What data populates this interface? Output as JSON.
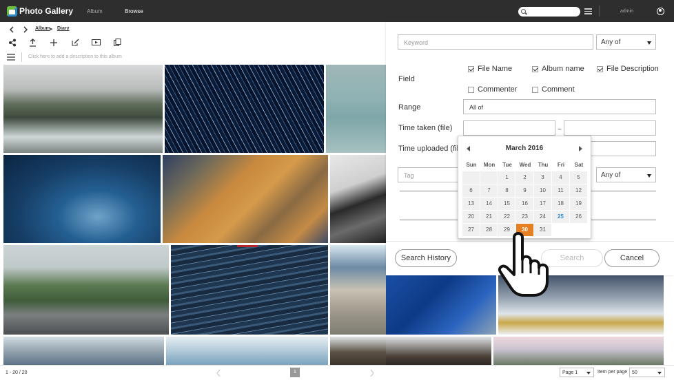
{
  "app": {
    "title": "Photo Gallery"
  },
  "nav": {
    "album": "Album",
    "browse": "Browse"
  },
  "header": {
    "user": "admin"
  },
  "breadcrumb": {
    "album": "Album",
    "sep": "▸",
    "current": "Diary"
  },
  "album": {
    "description_placeholder": "Click here to add a description to this album"
  },
  "icons": [
    "share-icon",
    "upload-icon",
    "add-icon",
    "edit-icon",
    "slideshow-icon",
    "copy-icon",
    "menu-icon",
    "search-icon",
    "filter-icon",
    "user-icon",
    "chevron-left-icon",
    "chevron-right-icon"
  ],
  "search": {
    "keyword_placeholder": "Keyword",
    "keyword_mode": "Any of",
    "field_label": "Field",
    "fields": [
      {
        "label": "File Name",
        "checked": true
      },
      {
        "label": "Album name",
        "checked": true
      },
      {
        "label": "File Description",
        "checked": true
      },
      {
        "label": "Commenter",
        "checked": false
      },
      {
        "label": "Comment",
        "checked": false
      }
    ],
    "range_label": "Range",
    "range_value": "All of",
    "time_taken_label": "Time taken (file)",
    "range_sep": "~",
    "time_uploaded_label": "Time uploaded (file)",
    "tag_placeholder": "Tag",
    "tag_mode": "Any of",
    "history_button": "Search History",
    "search_button": "Search",
    "cancel_button": "Cancel"
  },
  "calendar": {
    "month_year": "March  2016",
    "weekdays": [
      "Sun",
      "Mon",
      "Tue",
      "Wed",
      "Thu",
      "Fri",
      "Sat"
    ],
    "weeks": [
      [
        "",
        "",
        "1",
        "2",
        "3",
        "4",
        "5"
      ],
      [
        "6",
        "7",
        "8",
        "9",
        "10",
        "11",
        "12"
      ],
      [
        "13",
        "14",
        "15",
        "16",
        "17",
        "18",
        "19"
      ],
      [
        "20",
        "21",
        "22",
        "23",
        "24",
        "25",
        "26"
      ],
      [
        "27",
        "28",
        "29",
        "30",
        "31",
        "",
        ""
      ]
    ],
    "today": "25",
    "selected": "30"
  },
  "footer": {
    "range": "1 - 20 / 20",
    "page_num": "1",
    "page_select": "Page 1",
    "per_page_label": "Item per page",
    "per_page_value": "50"
  },
  "colors": {
    "topbar": "#2e2e2e",
    "accent": "#e67e22",
    "today": "#2f8ad8"
  }
}
